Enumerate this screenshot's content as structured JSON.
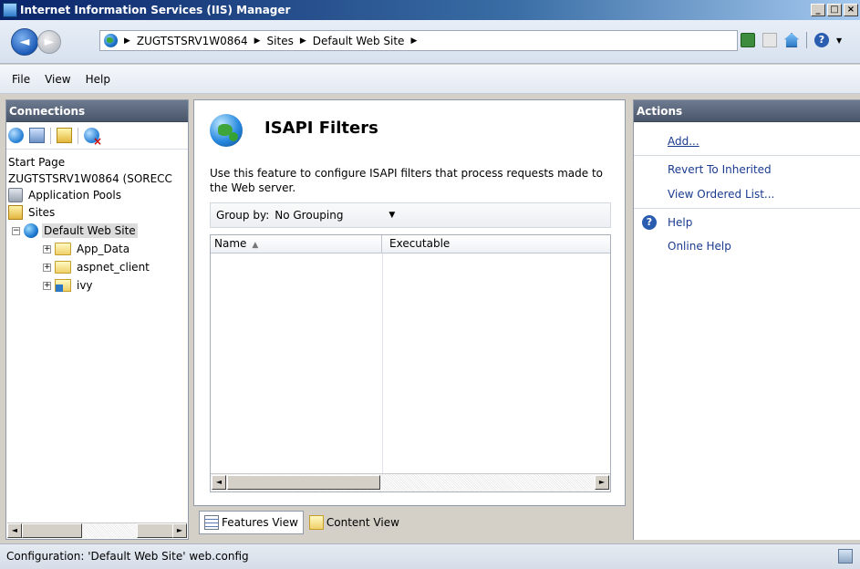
{
  "window": {
    "title": "Internet Information Services (IIS) Manager"
  },
  "address": {
    "crumbs": [
      "ZUGTSTSRV1W0864",
      "Sites",
      "Default Web Site"
    ]
  },
  "menu": [
    "File",
    "View",
    "Help"
  ],
  "connections": {
    "header": "Connections",
    "tree": {
      "start_page": "Start Page",
      "server": "ZUGTSTSRV1W0864 (SORECC",
      "app_pools": "Application Pools",
      "sites": "Sites",
      "default_site": "Default Web Site",
      "children": [
        "App_Data",
        "aspnet_client",
        "ivy"
      ]
    }
  },
  "feature": {
    "title": "ISAPI Filters",
    "description": "Use this feature to configure ISAPI filters that process requests made to the Web server.",
    "group_by_label": "Group by:",
    "group_by_value": "No Grouping",
    "columns": [
      "Name",
      "Executable"
    ]
  },
  "views": {
    "features": "Features View",
    "content": "Content View"
  },
  "actions": {
    "header": "Actions",
    "add": "Add...",
    "revert": "Revert To Inherited",
    "ordered": "View Ordered List...",
    "help": "Help",
    "online_help": "Online Help"
  },
  "status": {
    "text": "Configuration: 'Default Web Site' web.config"
  }
}
